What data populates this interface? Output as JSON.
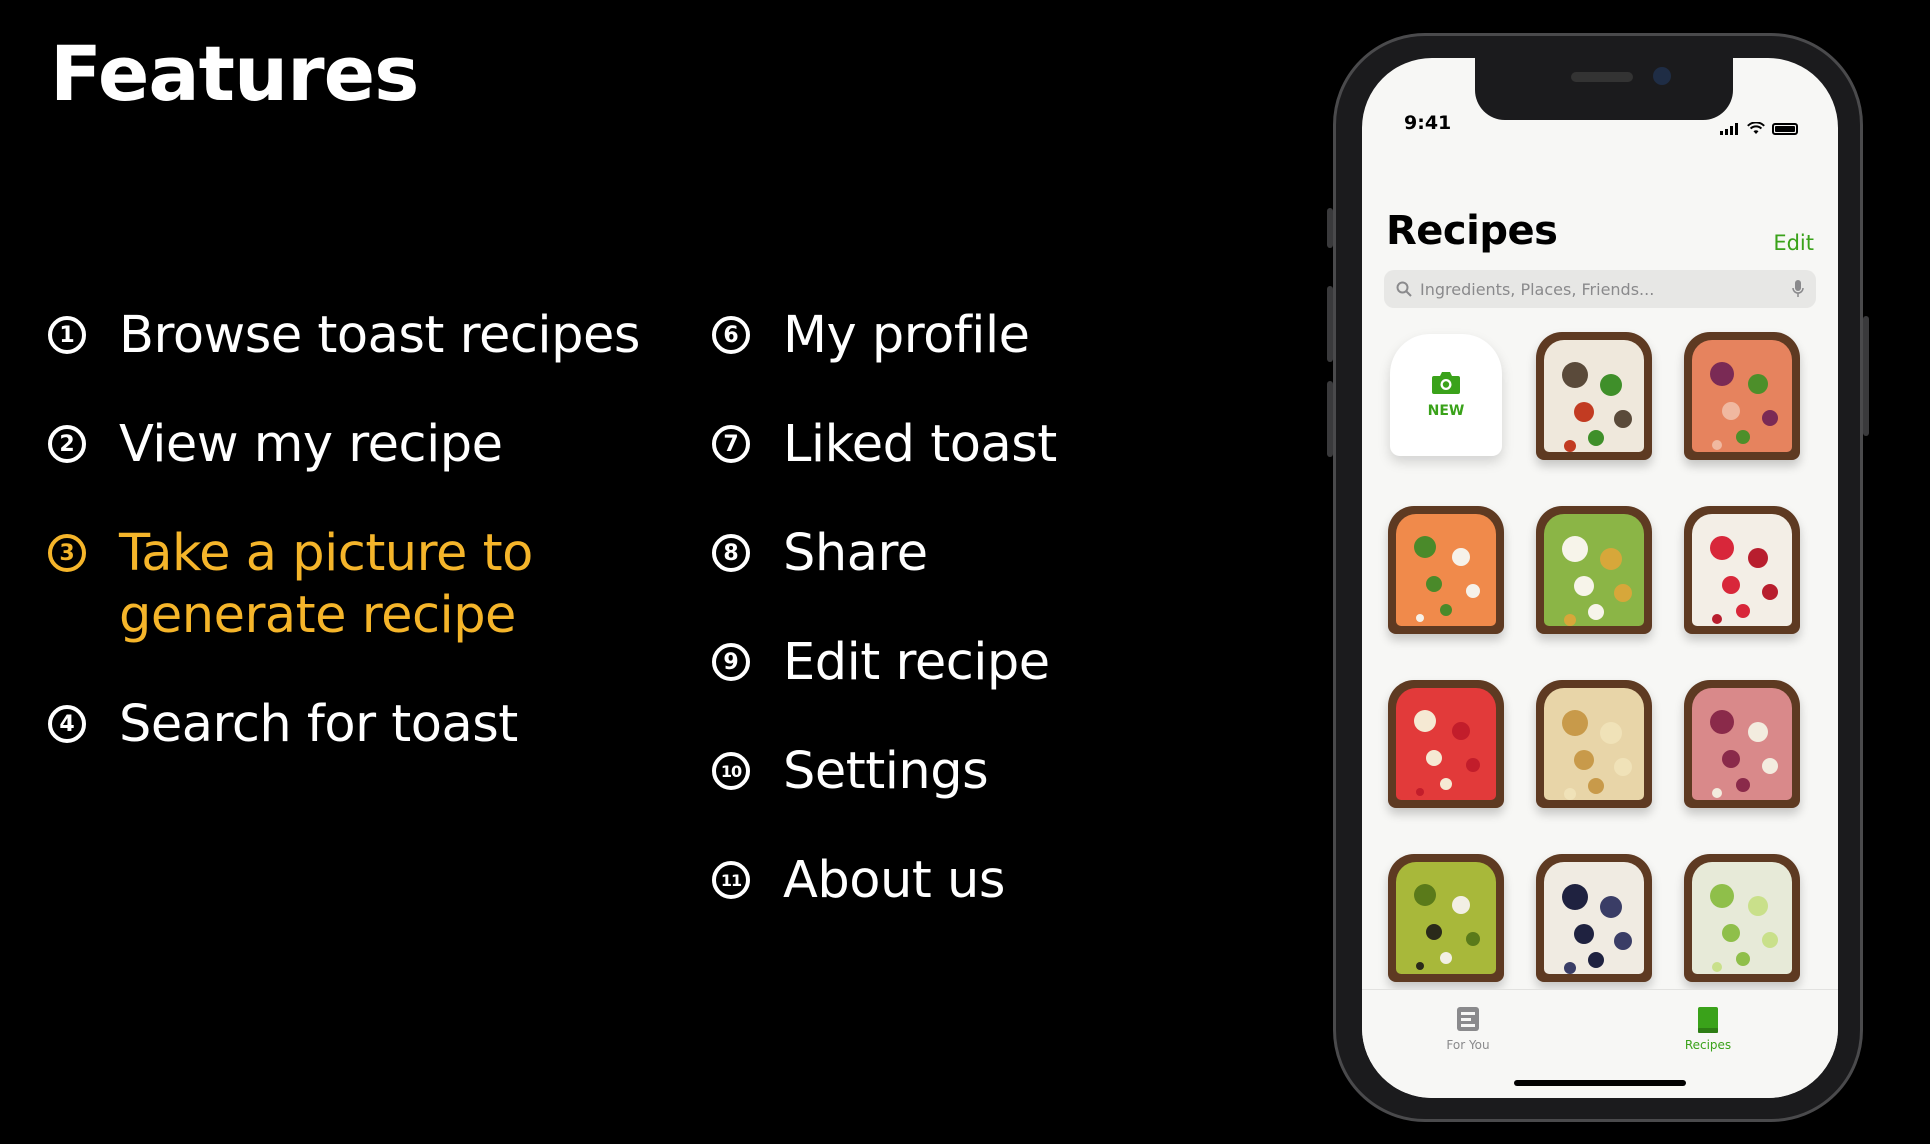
{
  "slide": {
    "title": "Features",
    "features_left": [
      {
        "num": "1",
        "label": "Browse toast recipes",
        "active": false
      },
      {
        "num": "2",
        "label": "View my recipe",
        "active": false
      },
      {
        "num": "3",
        "label": "Take a picture to generate recipe",
        "active": true
      },
      {
        "num": "4",
        "label": "Search for toast",
        "active": false
      }
    ],
    "features_right": [
      {
        "num": "6",
        "label": "My profile"
      },
      {
        "num": "7",
        "label": "Liked toast"
      },
      {
        "num": "8",
        "label": "Share"
      },
      {
        "num": "9",
        "label": "Edit recipe"
      },
      {
        "num": "10",
        "label": "Settings"
      },
      {
        "num": "11",
        "label": "About us"
      }
    ],
    "highlight_color": "#f5b52a"
  },
  "phone": {
    "status": {
      "time": "9:41"
    },
    "header": {
      "title": "Recipes",
      "edit_label": "Edit"
    },
    "search": {
      "placeholder": "Ingredients, Places, Friends..."
    },
    "new_tile": {
      "label": "NEW",
      "icon": "camera-icon"
    },
    "toasts": [
      {
        "name": "mushroom-pepper-toast",
        "base": "#efe8dc",
        "toppings": [
          "#5a4a3a",
          "#3f8f2a",
          "#c23b22"
        ]
      },
      {
        "name": "salmon-onion-toast",
        "base": "#e6835e",
        "toppings": [
          "#7a2a55",
          "#4d8f2a",
          "#f0b8a0"
        ]
      },
      {
        "name": "salmon-arugula-toast",
        "base": "#f08a4b",
        "toppings": [
          "#4a8a2a",
          "#f6f2ea"
        ]
      },
      {
        "name": "avocado-egg-toast",
        "base": "#8bb546",
        "toppings": [
          "#f7f4ea",
          "#d7a73a"
        ]
      },
      {
        "name": "strawberry-toast",
        "base": "#f3eee6",
        "toppings": [
          "#d8273a",
          "#b81e2e"
        ]
      },
      {
        "name": "strawberry-almond-toast",
        "base": "#e23a3a",
        "toppings": [
          "#f5e9d3",
          "#c21d2b"
        ]
      },
      {
        "name": "banana-toast",
        "base": "#e8d5a8",
        "toppings": [
          "#c89a4a",
          "#f0e2b8"
        ]
      },
      {
        "name": "fig-ham-toast",
        "base": "#d9898a",
        "toppings": [
          "#8a2a4a",
          "#f3ecdf"
        ]
      },
      {
        "name": "kiwi-toast",
        "base": "#a8b83a",
        "toppings": [
          "#5a7a1a",
          "#f2efe4",
          "#2a2a1a"
        ]
      },
      {
        "name": "blueberry-toast",
        "base": "#f0ebe2",
        "toppings": [
          "#1f2240",
          "#3a3d66"
        ]
      },
      {
        "name": "cucumber-toast",
        "base": "#e7ead8",
        "toppings": [
          "#8fbf4a",
          "#c9e08a"
        ]
      }
    ],
    "tabbar": [
      {
        "label": "For You",
        "icon": "for-you-icon",
        "active": false
      },
      {
        "label": "Recipes",
        "icon": "recipes-book-icon",
        "active": true
      }
    ],
    "accent": "#3aa21a"
  }
}
